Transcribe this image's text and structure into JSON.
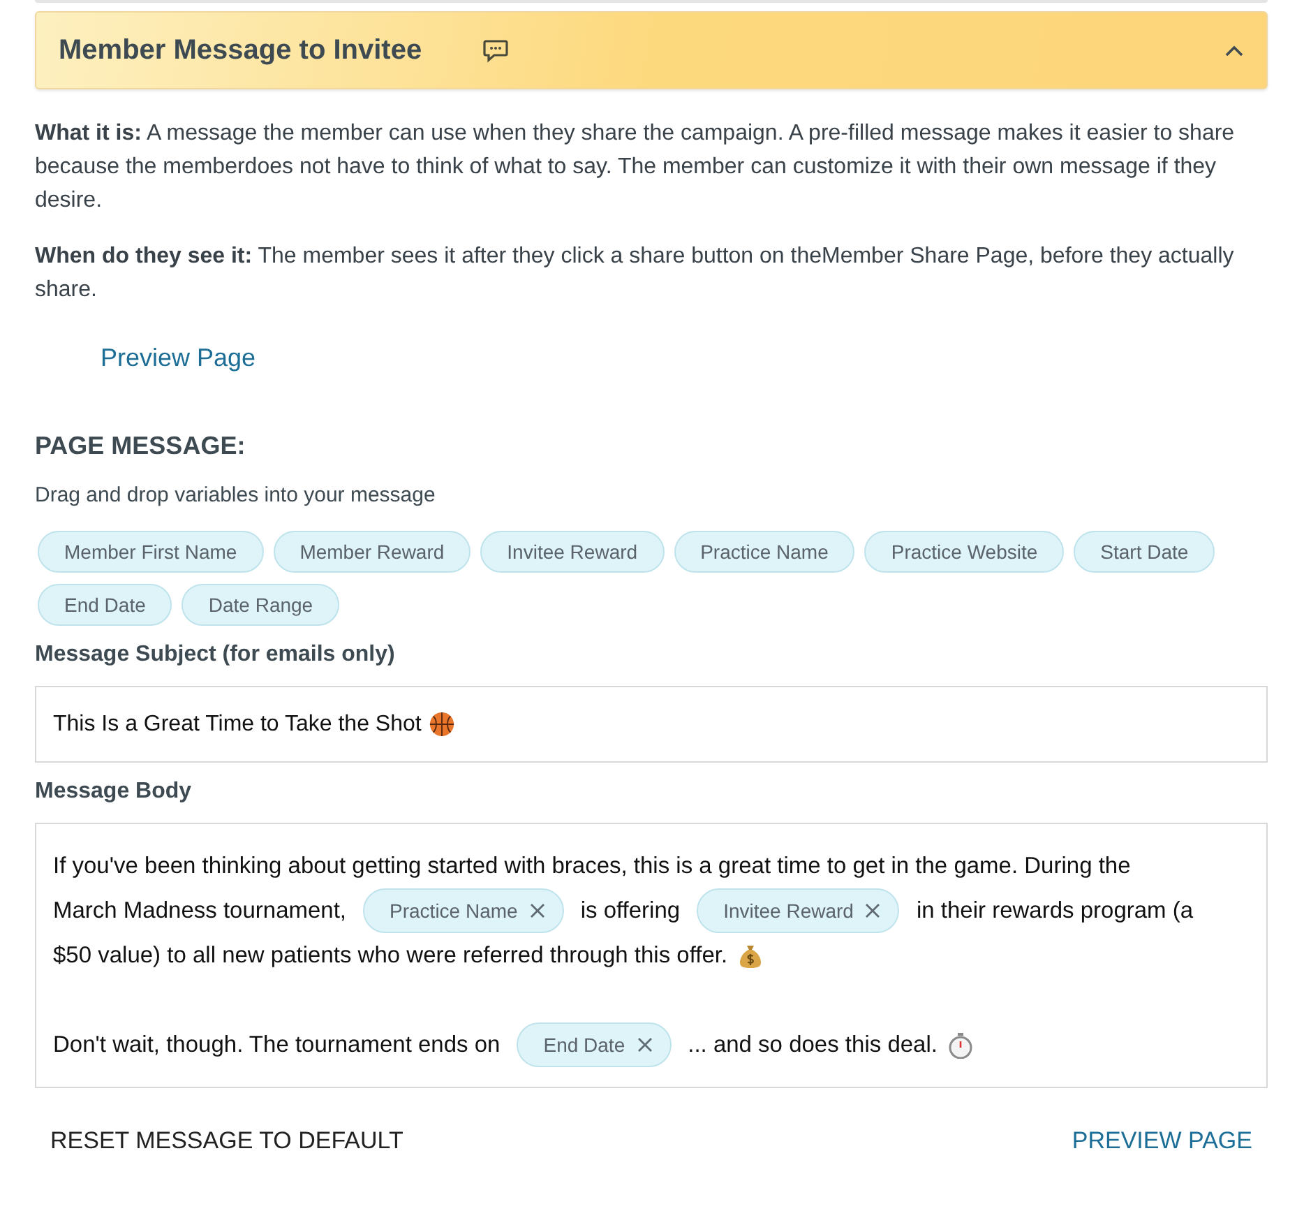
{
  "header": {
    "title": "Member Message to Invitee",
    "expanded": true
  },
  "info": [
    {
      "label": "What it is:",
      "text": "A message the member can use when they share the campaign. A pre-filled message makes it easier to share because the memberdoes not have to think of what to say. The member can customize it with their own message if they desire."
    },
    {
      "label": "When do they see it:",
      "text": "The member sees it after they click a share button on theMember Share Page, before they actually share."
    }
  ],
  "preview_link": "Preview Page",
  "section_title": "PAGE MESSAGE:",
  "hint": "Drag and drop variables into your message",
  "variables": [
    "Member First Name",
    "Member Reward",
    "Invitee Reward",
    "Practice Name",
    "Practice Website",
    "Start Date",
    "End Date",
    "Date Range"
  ],
  "subject": {
    "label": "Message Subject (for emails only)",
    "segments": [
      {
        "kind": "text",
        "text": "This Is a Great Time to Take the Shot"
      },
      {
        "kind": "ball"
      }
    ]
  },
  "body": {
    "label": "Message Body",
    "paragraphs": [
      [
        [
          {
            "kind": "text",
            "text": "If you've been thinking about getting started with braces, this is a great time to get in the game. During the"
          }
        ],
        [
          {
            "kind": "text",
            "text": "March Madness tournament,"
          },
          {
            "kind": "token",
            "text": "Practice Name"
          },
          {
            "kind": "text",
            "text": "is offering"
          },
          {
            "kind": "token",
            "text": "Invitee Reward"
          },
          {
            "kind": "text",
            "text": "in their rewards program (a"
          }
        ],
        [
          {
            "kind": "text",
            "text": "$50 value) to all new patients who were referred through this offer."
          },
          {
            "kind": "bag"
          }
        ]
      ],
      [
        [
          {
            "kind": "text",
            "text": "Don't wait, though. The tournament ends on"
          },
          {
            "kind": "token",
            "text": "End Date"
          },
          {
            "kind": "text",
            "text": "... and so does this deal."
          },
          {
            "kind": "timer"
          }
        ]
      ]
    ]
  },
  "footer": {
    "reset": "RESET MESSAGE TO DEFAULT",
    "preview": "PREVIEW PAGE"
  }
}
